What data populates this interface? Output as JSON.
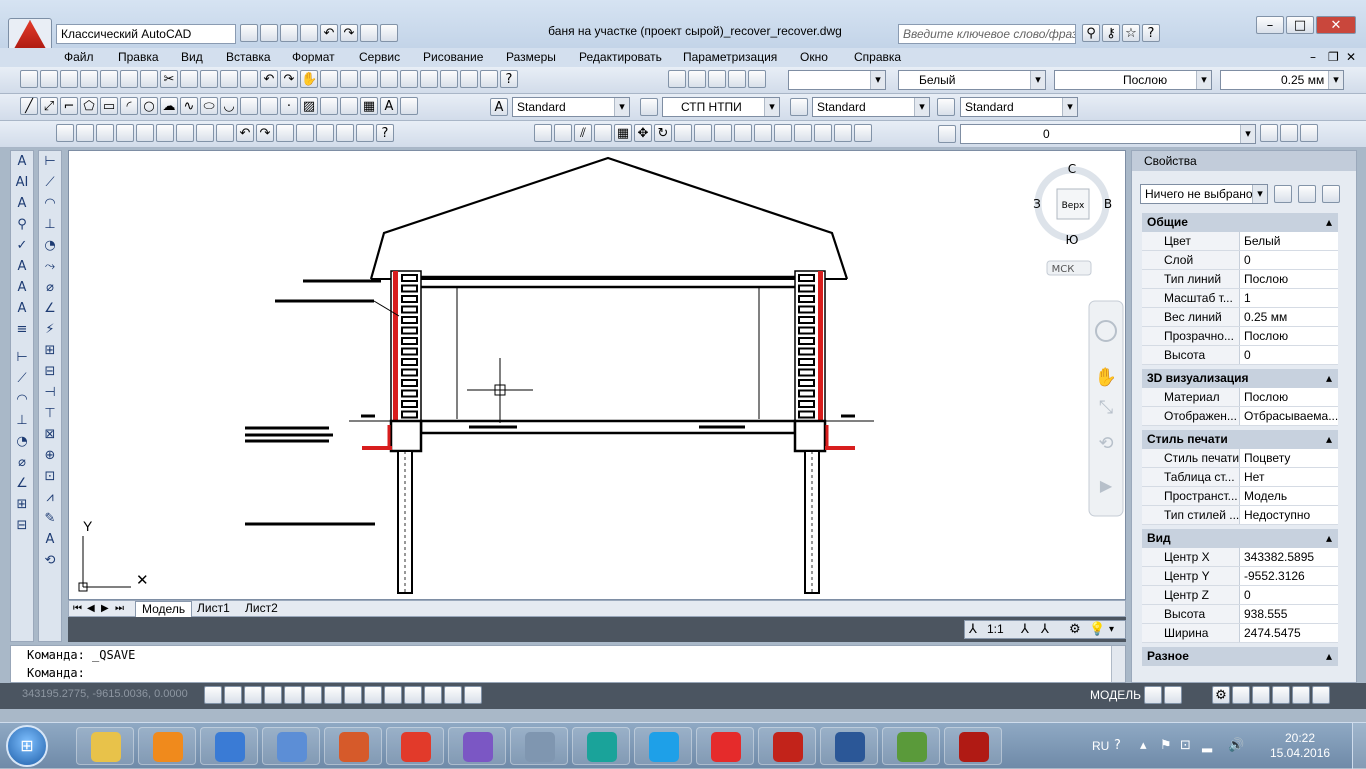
{
  "title": {
    "workspace": "Классический AutoCAD",
    "filename": "баня на участке (проект сырой)_recover_recover.dwg",
    "search_placeholder": "Введите ключевое слово/фразу"
  },
  "menu": [
    "Файл",
    "Правка",
    "Вид",
    "Вставка",
    "Формат",
    "Сервис",
    "Рисование",
    "Размеры",
    "Редактировать",
    "Параметризация",
    "Окно",
    "Справка"
  ],
  "toolbar1": {
    "color": "Белый",
    "linetype": "Послою",
    "lineweight": "0.25 мм"
  },
  "toolbar2": {
    "textstyle": "Standard",
    "dimstyle": "СТП НТПИ",
    "tablestyle": "Standard",
    "mleaderstyle": "Standard"
  },
  "toolbar3": {
    "layer": "0"
  },
  "viewcube": {
    "north": "С",
    "south": "Ю",
    "west": "З",
    "east": "В",
    "top": "Верх",
    "ucs": "МСК"
  },
  "ucs_icon": {
    "y": "Y"
  },
  "tabs": [
    "Модель",
    "Лист1",
    "Лист2"
  ],
  "canvas_status": {
    "scale": "1:1"
  },
  "command": {
    "line1": "Команда:  _QSAVE",
    "line2": "Команда:"
  },
  "status": {
    "coords": "343195.2775, -9615.0036, 0.0000",
    "model": "МОДЕЛЬ"
  },
  "properties": {
    "title": "Свойства",
    "selection": "Ничего не выбрано",
    "sections": [
      {
        "name": "Общие",
        "rows": [
          {
            "k": "Цвет",
            "v": "Белый"
          },
          {
            "k": "Слой",
            "v": "0"
          },
          {
            "k": "Тип линий",
            "v": "Послою"
          },
          {
            "k": "Масштаб т...",
            "v": "1"
          },
          {
            "k": "Вес линий",
            "v": "0.25 мм"
          },
          {
            "k": "Прозрачно...",
            "v": "Послою"
          },
          {
            "k": "Высота",
            "v": "0"
          }
        ]
      },
      {
        "name": "3D визуализация",
        "rows": [
          {
            "k": "Материал",
            "v": "Послою"
          },
          {
            "k": "Отображен...",
            "v": "Отбрасываема..."
          }
        ]
      },
      {
        "name": "Стиль печати",
        "rows": [
          {
            "k": "Стиль печати",
            "v": "Поцвету"
          },
          {
            "k": "Таблица ст...",
            "v": "Нет"
          },
          {
            "k": "Пространст...",
            "v": "Модель"
          },
          {
            "k": "Тип стилей ...",
            "v": "Недоступно"
          }
        ]
      },
      {
        "name": "Вид",
        "rows": [
          {
            "k": "Центр X",
            "v": "343382.5895"
          },
          {
            "k": "Центр Y",
            "v": "-9552.3126"
          },
          {
            "k": "Центр Z",
            "v": "0"
          },
          {
            "k": "Высота",
            "v": "938.555"
          },
          {
            "k": "Ширина",
            "v": "2474.5475"
          }
        ]
      },
      {
        "name": "Разное",
        "rows": []
      }
    ]
  },
  "taskbar": {
    "lang": "RU",
    "time": "20:22",
    "date": "15.04.2016",
    "apps": [
      {
        "name": "explorer",
        "color": "#e8c24a"
      },
      {
        "name": "media-player",
        "color": "#f08a1c"
      },
      {
        "name": "mail",
        "color": "#3a7bd5"
      },
      {
        "name": "sound",
        "color": "#5c8ed6"
      },
      {
        "name": "archive",
        "color": "#d65a2a"
      },
      {
        "name": "yandex",
        "color": "#e23a2a"
      },
      {
        "name": "viber",
        "color": "#7b57c4"
      },
      {
        "name": "calculator",
        "color": "#7f96b0"
      },
      {
        "name": "eset",
        "color": "#1aa39a"
      },
      {
        "name": "skype",
        "color": "#1ea0e8"
      },
      {
        "name": "yandex-browser",
        "color": "#e52b2b"
      },
      {
        "name": "autocad",
        "color": "#c2231a"
      },
      {
        "name": "word",
        "color": "#2b5797"
      },
      {
        "name": "paint",
        "color": "#5a9a3a"
      },
      {
        "name": "acrobat",
        "color": "#b01a14"
      }
    ]
  }
}
